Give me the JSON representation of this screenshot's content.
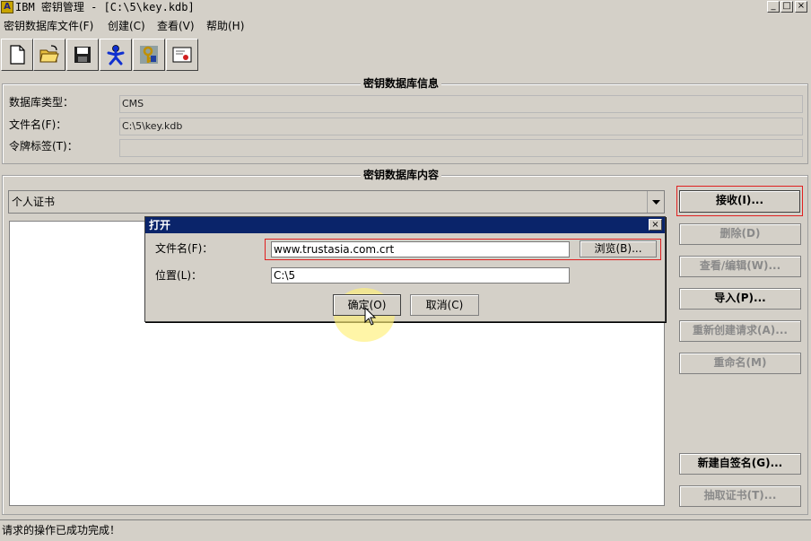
{
  "window": {
    "title": "IBM 密钥管理 - [C:\\5\\key.kdb]",
    "app_icon": "ikeyman-icon",
    "controls": [
      "_",
      "□",
      "×"
    ]
  },
  "menu": [
    {
      "label": "密钥数据库文件(F)"
    },
    {
      "label": "创建(C)"
    },
    {
      "label": "查看(V)"
    },
    {
      "label": "帮助(H)"
    }
  ],
  "toolbar": {
    "icons": [
      "new-file-icon",
      "open-folder-icon",
      "save-icon",
      "person-icon",
      "key-icon",
      "certificate-icon"
    ]
  },
  "db_info": {
    "section_title": "密钥数据库信息",
    "type_label": "数据库类型：",
    "type_value": "CMS",
    "filename_label": "文件名(F)：",
    "filename_value": "C:\\5\\key.kdb",
    "token_label": "令牌标签(T)：",
    "token_value": ""
  },
  "db_content": {
    "section_title": "密钥数据库内容",
    "dropdown_value": "个人证书",
    "buttons": {
      "receive": "接收(I)...",
      "delete": "删除(D)",
      "view_edit": "查看/编辑(W)...",
      "import": "导入(P)...",
      "recreate_request": "重新创建请求(A)...",
      "rename": "重命名(M)",
      "new_self_signed": "新建自签名(G)...",
      "extract_cert": "抽取证书(T)..."
    }
  },
  "dialog": {
    "title": "打开",
    "close": "×",
    "filename_label": "文件名(F)：",
    "filename_value": "www.trustasia.com.crt",
    "browse_label": "浏览(B)...",
    "location_label": "位置(L)：",
    "location_value": "C:\\5",
    "ok_label": "确定(O)",
    "cancel_label": "取消(C)"
  },
  "status_bar": {
    "text": "请求的操作已成功完成！"
  },
  "colors": {
    "background": "#d4d0c8",
    "dialog_title": "#0a246a",
    "highlight": "#e02020"
  }
}
